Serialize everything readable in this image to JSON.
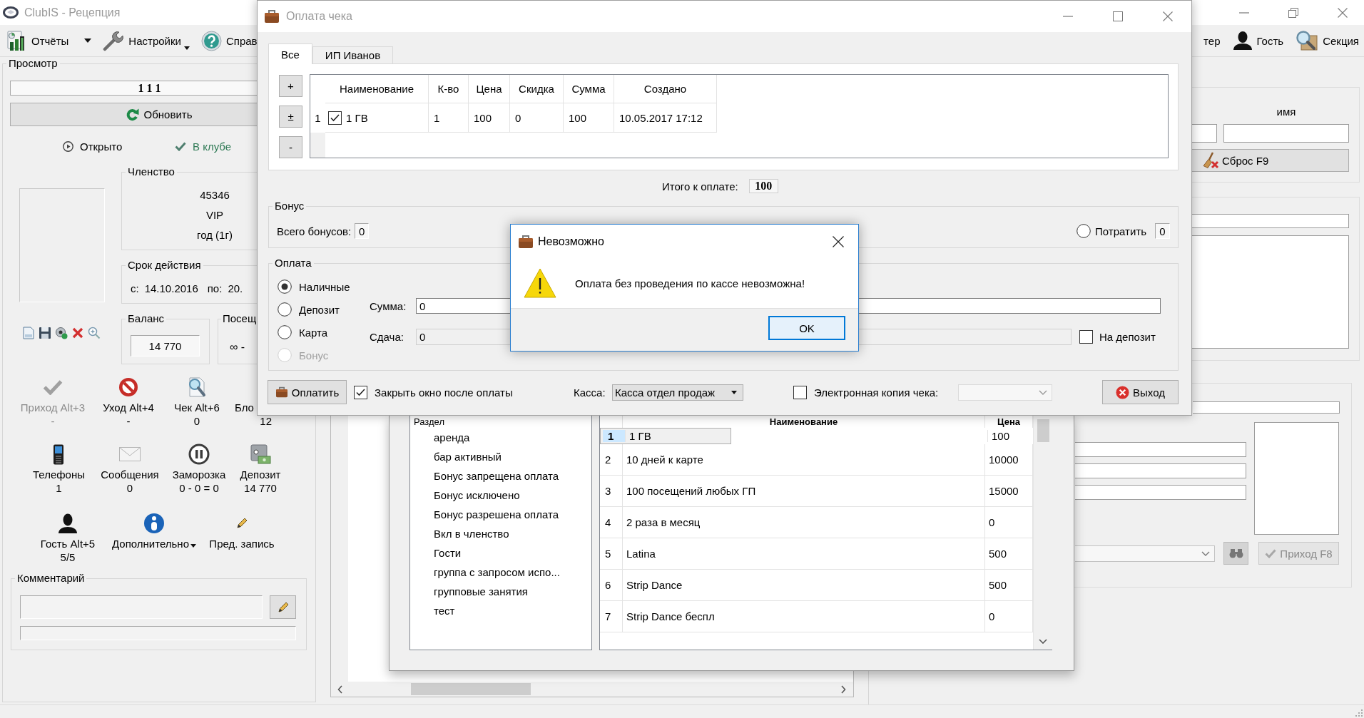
{
  "main_window": {
    "title": "ClubIS - Рецепция",
    "active": false,
    "toolbar_left": [
      {
        "label": "Отчёты",
        "kind": "split"
      },
      {
        "label": "Настройки",
        "kind": "menu"
      },
      {
        "label": "Справ",
        "kind": "plain"
      }
    ],
    "toolbar_right": [
      {
        "label": "тер"
      },
      {
        "label": "Гость"
      },
      {
        "label": "Секция"
      }
    ],
    "view_panel": {
      "title": "Просмотр",
      "card_number": "1 1 1",
      "refresh_button": "Обновить",
      "statuses": [
        {
          "kind": "open",
          "label": "Открыто"
        },
        {
          "kind": "in_club",
          "label": "В клубе"
        }
      ],
      "membership": {
        "title": "Членство",
        "lines": [
          "45346",
          "VIP",
          "год (1г)"
        ]
      },
      "validity": {
        "title": "Срок действия",
        "from_label": "с:",
        "from": "14.10.2016",
        "to_label": "по:",
        "to": "20."
      },
      "balance": {
        "title": "Баланс",
        "value": "14 770"
      },
      "visits": {
        "title": "Посещ",
        "value": "∞ -"
      },
      "action_rows": [
        {
          "items": [
            {
              "label": "Приход Alt+3",
              "value": "-",
              "kind": "plain",
              "disabled": true
            },
            {
              "label": "Уход Alt+4",
              "value": "-",
              "kind": "plain",
              "disabled": false
            },
            {
              "label": "Чек Alt+6",
              "value": "0",
              "kind": "plain",
              "disabled": false
            },
            {
              "label": "Бло",
              "value": "12",
              "kind": "plain",
              "disabled": false
            }
          ]
        },
        {
          "items": [
            {
              "label": "Телефоны",
              "value": "1",
              "kind": "plain",
              "disabled": false
            },
            {
              "label": "Сообщения",
              "value": "0",
              "kind": "plain",
              "disabled": false
            },
            {
              "label": "Заморозка",
              "value": "0 - 0 = 0",
              "kind": "plain",
              "disabled": false
            },
            {
              "label": "Депозит",
              "value": "14 770",
              "kind": "plain",
              "disabled": false
            }
          ]
        },
        {
          "items": [
            {
              "label": "Гость Alt+5",
              "value": "5/5",
              "kind": "plain",
              "disabled": false
            },
            {
              "label": "Дополнительно",
              "kind": "menu",
              "disabled": false
            },
            {
              "label": "Пред. запись",
              "kind": "plain",
              "disabled": false
            }
          ]
        }
      ],
      "comment": {
        "title": "Комментарий"
      }
    },
    "right_panel": {
      "name_label": "имя",
      "reset_button": "Сброс F9",
      "arrival_button": {
        "label": "Приход F8",
        "disabled": true
      }
    }
  },
  "product_window": {
    "categories": {
      "header": "Раздел",
      "items": [
        {
          "label": "аренда",
          "selected": false
        },
        {
          "label": "бар активный",
          "selected": false
        },
        {
          "label": "Бонус запрещена оплата",
          "selected": false
        },
        {
          "label": "Бонус исключено",
          "selected": false
        },
        {
          "label": "Бонус разрешена оплата",
          "selected": false
        },
        {
          "label": "Вкл в членство",
          "selected": false
        },
        {
          "label": "Гости",
          "selected": false
        },
        {
          "label": "группа с запросом испо...",
          "selected": false
        },
        {
          "label": "групповые занятия",
          "selected": false
        },
        {
          "label": "тест",
          "selected": false
        }
      ]
    },
    "table": {
      "columns": [
        "Наименование",
        "Цена"
      ],
      "rows": [
        {
          "number": "1",
          "name": "1 ГВ",
          "price": "100",
          "selected": true
        },
        {
          "number": "2",
          "name": "10 дней к карте",
          "price": "10000",
          "selected": false
        },
        {
          "number": "3",
          "name": "100 посещений любых ГП",
          "price": "15000",
          "selected": false
        },
        {
          "number": "4",
          "name": "2 раза в месяц",
          "price": "0",
          "selected": false
        },
        {
          "number": "5",
          "name": "Latina",
          "price": "500",
          "selected": false
        },
        {
          "number": "6",
          "name": "Strip Dance",
          "price": "500",
          "selected": false
        },
        {
          "number": "7",
          "name": "Strip Dance беспл",
          "price": "0",
          "selected": false
        }
      ]
    }
  },
  "payment_dialog": {
    "title": "Оплата чека",
    "active": false,
    "tabs": [
      {
        "label": "Все",
        "selected": true
      },
      {
        "label": "ИП Иванов",
        "selected": false
      }
    ],
    "row_buttons": [
      "+",
      "±",
      "-"
    ],
    "table": {
      "columns": [
        "Наименование",
        "К-во",
        "Цена",
        "Скидка",
        "Сумма",
        "Создано"
      ],
      "rows": [
        {
          "number": "1",
          "checked": true,
          "cells": [
            "1 ГВ",
            "1",
            "100",
            "0",
            "100",
            "10.05.2017 17:12"
          ]
        }
      ]
    },
    "total": {
      "label": "Итого к оплате:",
      "value": "100"
    },
    "bonus": {
      "title": "Бонус",
      "total_label": "Всего бонусов:",
      "total": "0",
      "spend": {
        "label": "Потратить",
        "selected": false
      },
      "spend_value": "0"
    },
    "payment": {
      "title": "Оплата",
      "methods": [
        {
          "label": "Наличные",
          "selected": true,
          "disabled": false
        },
        {
          "label": "Депозит",
          "selected": false,
          "disabled": false
        },
        {
          "label": "Карта",
          "selected": false,
          "disabled": false
        },
        {
          "label": "Бонус",
          "selected": false,
          "disabled": true
        }
      ],
      "amount_label": "Сумма:",
      "amount": {
        "value": "0",
        "disabled": false
      },
      "change_label": "Сдача:",
      "change": {
        "value": "0",
        "disabled": true
      },
      "to_deposit": {
        "label": "На депозит",
        "checked": false
      }
    },
    "pay_button": "Оплатить",
    "close_after": {
      "label": "Закрыть окно после оплаты",
      "checked": true
    },
    "register_label": "Касса:",
    "register": "Касса отдел продаж",
    "e_receipt": {
      "label": "Электронная копия чека:",
      "checked": false
    },
    "e_receipt_select": {
      "disabled": true
    },
    "exit_button": "Выход"
  },
  "alert": {
    "title": "Невозможно",
    "active": true,
    "message": "Оплата без проведения по кассе невозможна!",
    "button": {
      "label": "OK",
      "focused": true
    }
  }
}
